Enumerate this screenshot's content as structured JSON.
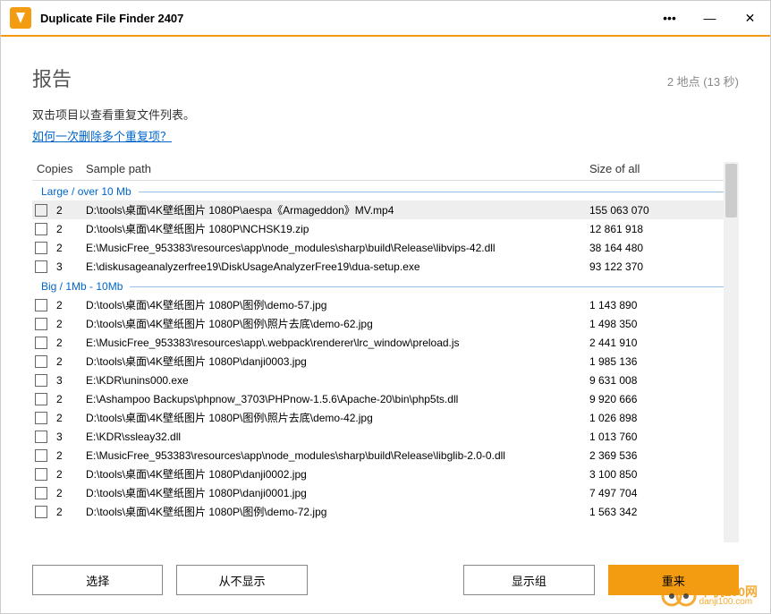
{
  "window": {
    "title": "Duplicate File Finder 2407"
  },
  "report": {
    "title": "报告",
    "meta": "2 地点 (13 秒)",
    "instructions": "双击项目以查看重复文件列表。",
    "help_link": "如何一次删除多个重复项？"
  },
  "columns": {
    "copies": "Copies",
    "path": "Sample path",
    "size": "Size of all"
  },
  "groups": [
    {
      "label": "Large / over 10 Mb",
      "rows": [
        {
          "copies": "2",
          "path": "D:\\tools\\桌面\\4K壁纸图片 1080P\\aespa《Armageddon》MV.mp4",
          "size": "155 063 070",
          "selected": true
        },
        {
          "copies": "2",
          "path": "D:\\tools\\桌面\\4K壁纸图片 1080P\\NCHSK19.zip",
          "size": "12 861 918"
        },
        {
          "copies": "2",
          "path": "E:\\MusicFree_953383\\resources\\app\\node_modules\\sharp\\build\\Release\\libvips-42.dll",
          "size": "38 164 480"
        },
        {
          "copies": "3",
          "path": "E:\\diskusageanalyzerfree19\\DiskUsageAnalyzerFree19\\dua-setup.exe",
          "size": "93 122 370"
        }
      ]
    },
    {
      "label": "Big / 1Mb - 10Mb",
      "rows": [
        {
          "copies": "2",
          "path": "D:\\tools\\桌面\\4K壁纸图片 1080P\\图例\\demo-57.jpg",
          "size": "1 143 890"
        },
        {
          "copies": "2",
          "path": "D:\\tools\\桌面\\4K壁纸图片 1080P\\图例\\照片去底\\demo-62.jpg",
          "size": "1 498 350"
        },
        {
          "copies": "2",
          "path": "E:\\MusicFree_953383\\resources\\app\\.webpack\\renderer\\lrc_window\\preload.js",
          "size": "2 441 910"
        },
        {
          "copies": "2",
          "path": "D:\\tools\\桌面\\4K壁纸图片 1080P\\danji0003.jpg",
          "size": "1 985 136"
        },
        {
          "copies": "3",
          "path": "E:\\KDR\\unins000.exe",
          "size": "9 631 008"
        },
        {
          "copies": "2",
          "path": "E:\\Ashampoo Backups\\phpnow_3703\\PHPnow-1.5.6\\Apache-20\\bin\\php5ts.dll",
          "size": "9 920 666"
        },
        {
          "copies": "2",
          "path": "D:\\tools\\桌面\\4K壁纸图片 1080P\\图例\\照片去底\\demo-42.jpg",
          "size": "1 026 898"
        },
        {
          "copies": "3",
          "path": "E:\\KDR\\ssleay32.dll",
          "size": "1 013 760"
        },
        {
          "copies": "2",
          "path": "E:\\MusicFree_953383\\resources\\app\\node_modules\\sharp\\build\\Release\\libglib-2.0-0.dll",
          "size": "2 369 536"
        },
        {
          "copies": "2",
          "path": "D:\\tools\\桌面\\4K壁纸图片 1080P\\danji0002.jpg",
          "size": "3 100 850"
        },
        {
          "copies": "2",
          "path": "D:\\tools\\桌面\\4K壁纸图片 1080P\\danji0001.jpg",
          "size": "7 497 704"
        },
        {
          "copies": "2",
          "path": "D:\\tools\\桌面\\4K壁纸图片 1080P\\图例\\demo-72.jpg",
          "size": "1 563 342"
        }
      ]
    }
  ],
  "footer": {
    "select": "选择",
    "never_show": "从不显示",
    "show_group": "显示组",
    "restart": "重来"
  },
  "watermark": {
    "main": "单机100网",
    "sub": "danji100.com"
  }
}
